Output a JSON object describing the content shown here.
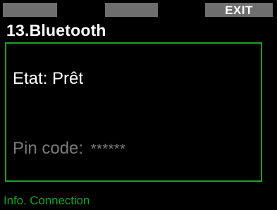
{
  "softkeys": {
    "left_label": "",
    "middle_label": "",
    "right_label": "EXIT"
  },
  "menu": {
    "title": "13.Bluetooth"
  },
  "bluetooth": {
    "status_label": "Etat:",
    "status_value": "Prêt",
    "pin_label": "Pin code:",
    "pin_value": "******"
  },
  "footer": {
    "text": "Info. Connection"
  },
  "colors": {
    "background": "#000000",
    "accent_green": "#1aa028",
    "softkey_gray": "#6e6e6e",
    "dimmed_text": "#7a7a7a"
  }
}
